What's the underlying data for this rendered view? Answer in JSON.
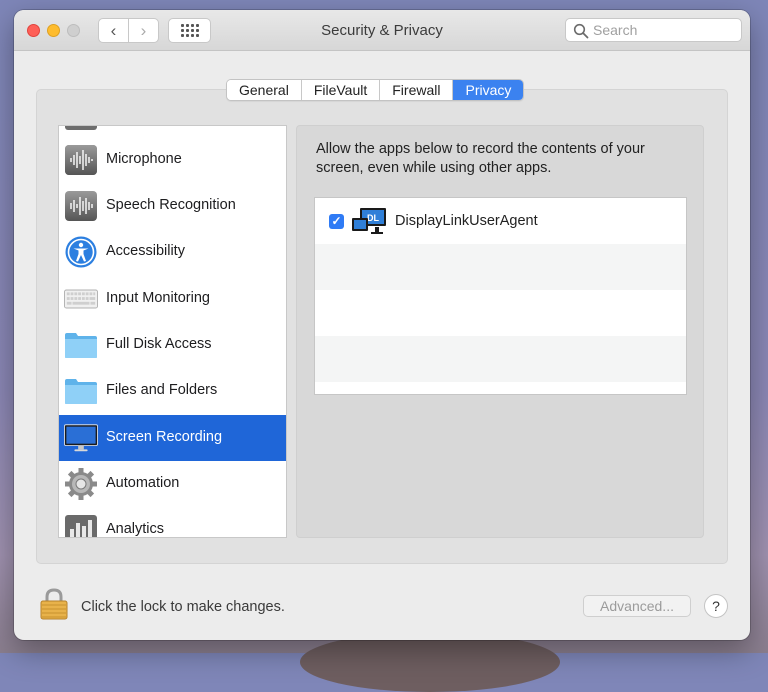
{
  "window": {
    "title": "Security & Privacy",
    "search_placeholder": "Search"
  },
  "tabs": [
    {
      "label": "General",
      "active": false
    },
    {
      "label": "FileVault",
      "active": false
    },
    {
      "label": "Firewall",
      "active": false
    },
    {
      "label": "Privacy",
      "active": true
    }
  ],
  "sidebar": {
    "items": [
      {
        "label": "Microphone",
        "icon": "microphone-icon"
      },
      {
        "label": "Speech Recognition",
        "icon": "speech-recognition-icon"
      },
      {
        "label": "Accessibility",
        "icon": "accessibility-icon"
      },
      {
        "label": "Input Monitoring",
        "icon": "keyboard-icon"
      },
      {
        "label": "Full Disk Access",
        "icon": "folder-icon"
      },
      {
        "label": "Files and Folders",
        "icon": "folder-icon"
      },
      {
        "label": "Screen Recording",
        "icon": "display-icon",
        "selected": true
      },
      {
        "label": "Automation",
        "icon": "gear-icon"
      },
      {
        "label": "Analytics",
        "icon": "analytics-icon"
      }
    ]
  },
  "main": {
    "description": "Allow the apps below to record the contents of your screen, even while using other apps.",
    "apps": [
      {
        "name": "DisplayLinkUserAgent",
        "checked": true,
        "icon": "displaylink-icon",
        "icon_text": "DL"
      }
    ]
  },
  "footer": {
    "lock_text": "Click the lock to make changes.",
    "advanced_label": "Advanced...",
    "help_label": "?"
  },
  "colors": {
    "accent": "#1f66d8",
    "tab_active": "#3b82f0",
    "checkbox": "#2f7bf5"
  }
}
